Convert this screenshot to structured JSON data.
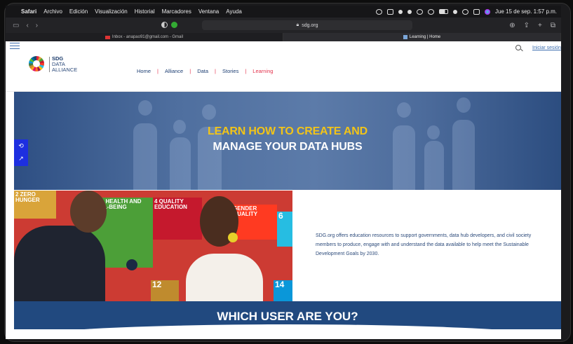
{
  "menubar": {
    "app": "Safari",
    "items": [
      "Archivo",
      "Edición",
      "Visualización",
      "Historial",
      "Marcadores",
      "Ventana",
      "Ayuda"
    ],
    "datetime": "Jue 15 de sep.  1:57 p.m."
  },
  "toolbar": {
    "url": "sdg.org"
  },
  "tabs": [
    {
      "label": "Inbox - anapao91@gmail.com - Gmail"
    },
    {
      "label": "Learning | Home"
    }
  ],
  "site": {
    "login": "Iniciar sesión",
    "logo": {
      "line1": "SDG",
      "line2": "DATA",
      "line3": "ALLIANCE"
    },
    "nav": [
      {
        "label": "Home"
      },
      {
        "label": "Alliance"
      },
      {
        "label": "Data"
      },
      {
        "label": "Stories"
      },
      {
        "label": "Learning"
      }
    ],
    "hero": {
      "line1": "LEARN HOW TO CREATE AND",
      "line2": "MANAGE YOUR DATA HUBS"
    },
    "photo_tiles": {
      "t2": "2  ZERO HUNGER",
      "t3": "OOD HEALTH AND WELL-BEING",
      "t4": "4  QUALITY EDUCATION",
      "t5": "GENDER QUALITY",
      "t6": "6",
      "t12": "12",
      "t14": "14"
    },
    "description": "SDG.org offers education resources to support governments, data hub developers, and civil society members to produce, engage with and understand the data available to help meet the Sustainable Development Goals by 2030.",
    "band_title": "WHICH USER ARE YOU?"
  },
  "colors": {
    "accent_yellow": "#f2c418",
    "nav_blue": "#1e3f73",
    "active_red": "#e3344e",
    "band_blue": "#21497f"
  }
}
